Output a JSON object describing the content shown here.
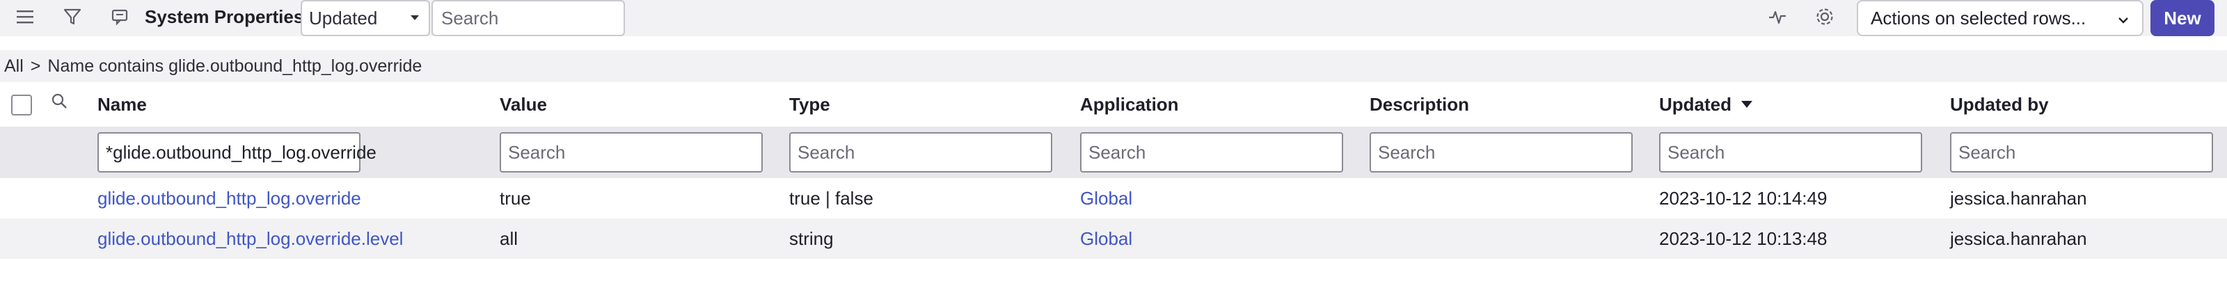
{
  "toolbar": {
    "title": "System Properties",
    "filter_select": "Updated",
    "search_placeholder": "Search",
    "actions_label": "Actions on selected rows...",
    "new_label": "New",
    "icons": [
      "menu-icon",
      "filter-icon",
      "comment-icon",
      "activity-icon",
      "settings-icon",
      "chevron-down-icon"
    ]
  },
  "breadcrumb": {
    "root": "All",
    "separator": ">",
    "condition": "Name contains glide.outbound_http_log.override"
  },
  "table": {
    "columns": [
      {
        "label": "Name"
      },
      {
        "label": "Value"
      },
      {
        "label": "Type"
      },
      {
        "label": "Application"
      },
      {
        "label": "Description"
      },
      {
        "label": "Updated"
      },
      {
        "label": "Updated by"
      }
    ],
    "filters": {
      "name": "*glide.outbound_http_log.override",
      "placeholder": "Search"
    },
    "rows": [
      {
        "name": "glide.outbound_http_log.override",
        "value": "true",
        "type": "true | false",
        "application": "Global",
        "description": "",
        "updated": "2023-10-12 10:14:49",
        "updated_by": "jessica.hanrahan"
      },
      {
        "name": "glide.outbound_http_log.override.level",
        "value": "all",
        "type": "string",
        "application": "Global",
        "description": "",
        "updated": "2023-10-12 10:13:48",
        "updated_by": "jessica.hanrahan"
      }
    ]
  },
  "colors": {
    "accent": "#4d4ab5",
    "link": "#3f55c9",
    "toolbar_bg": "#f2f2f4",
    "filter_bg": "#e7e7ec"
  }
}
